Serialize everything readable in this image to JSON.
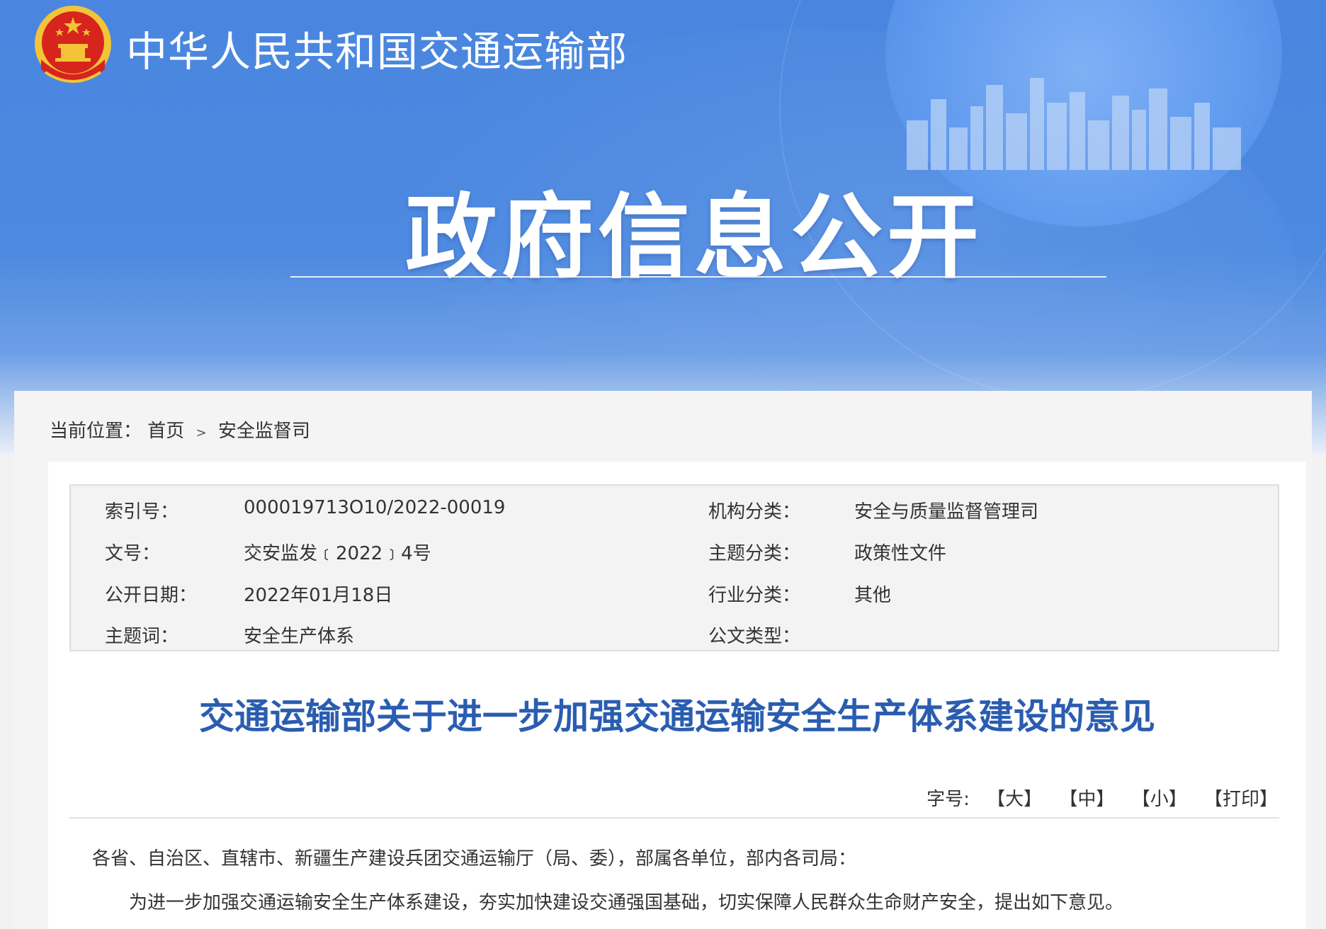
{
  "header": {
    "site_title": "中华人民共和国交通运输部",
    "section_title": "政府信息公开"
  },
  "breadcrumb": {
    "prefix": "当前位置：",
    "home": "首页",
    "separator": ">",
    "current": "安全监督司"
  },
  "meta": {
    "index_label": "索引号：",
    "index_value": "000019713O10/2022-00019",
    "org_label": "机构分类：",
    "org_value": "安全与质量监督管理司",
    "docno_label": "文号：",
    "docno_value": "交安监发﹝2022﹞4号",
    "topic_label": "主题分类：",
    "topic_value": "政策性文件",
    "date_label": "公开日期：",
    "date_value": "2022年01月18日",
    "industry_label": "行业分类：",
    "industry_value": "其他",
    "keyword_label": "主题词：",
    "keyword_value": "安全生产体系",
    "doctype_label": "公文类型：",
    "doctype_value": ""
  },
  "document": {
    "title": "交通运输部关于进一步加强交通运输安全生产体系建设的意见",
    "font_size_label": "字号:",
    "size_large": "【大】",
    "size_medium": "【中】",
    "size_small": "【小】",
    "print": "【打印】",
    "salutation": "各省、自治区、直辖市、新疆生产建设兵团交通运输厅（局、委），部属各单位，部内各司局：",
    "intro": "为进一步加强交通运输安全生产体系建设，夯实加快建设交通强国基础，切实保障人民群众生命财产安全，提出如下意见。"
  },
  "colors": {
    "banner_blue": "#4a86df",
    "title_blue": "#2a5db0",
    "emblem_red": "#d7241d",
    "emblem_gold": "#f3c437"
  }
}
